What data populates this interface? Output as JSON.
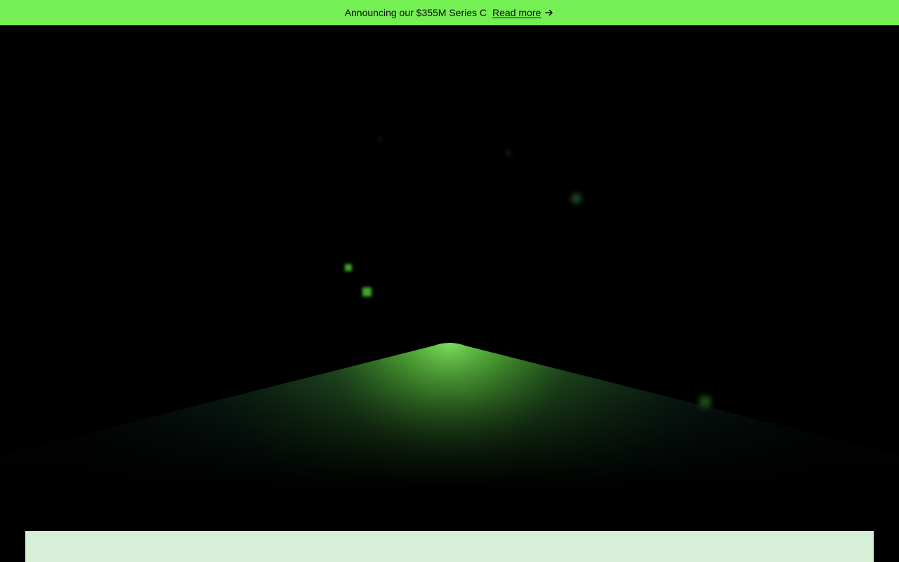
{
  "announcement": {
    "text": "Announcing our $355M Series C",
    "link_label": "Read more",
    "icon": "arrow-right-icon"
  },
  "colors": {
    "banner_bg": "#74ef54",
    "hero_bg": "#000000",
    "glow": "#6fe24c",
    "card_bg": "#d8efd7"
  }
}
